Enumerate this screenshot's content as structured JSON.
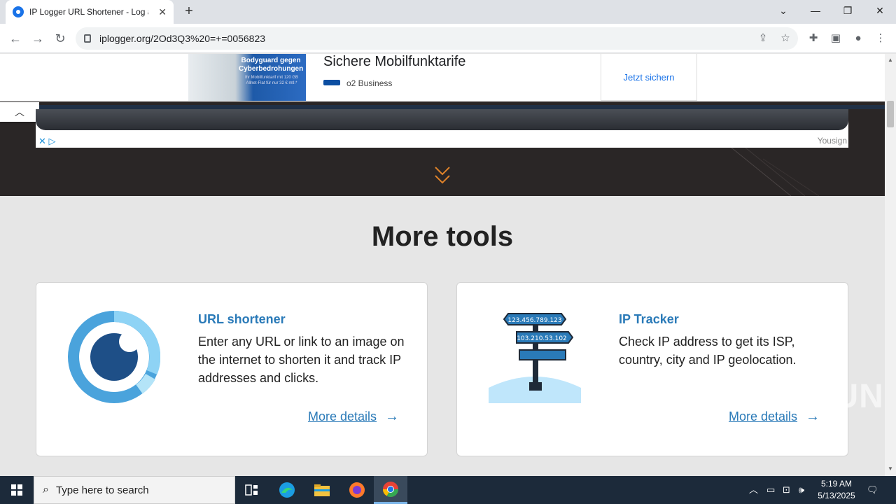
{
  "browser": {
    "tab_title": "IP Logger URL Shortener - Log a",
    "url": "iplogger.org/2Od3Q3%20=+=0056823",
    "new_tab": "+",
    "tab_close": "✕",
    "win_minimize": "—",
    "win_restore": "❐",
    "win_close": "✕",
    "tab_list": "⌄"
  },
  "ad_top": {
    "image_headline": "Bodyguard gegen Cyberbedrohungen",
    "image_small": "Ihr Mobilfunktarif mit 120 GB Allnet-Flat für nur 32 € mtl.*",
    "title": "Sichere Mobilfunktarife",
    "advertiser": "o2 Business",
    "cta": "Jetzt sichern"
  },
  "ad_banner": {
    "brand": "Yousign"
  },
  "main": {
    "heading": "More tools",
    "cards": [
      {
        "title": "URL shortener",
        "description": "Enter any URL or link to an image on the internet to shorten it and track IP addresses and clicks.",
        "link": "More details"
      },
      {
        "title": "IP Tracker",
        "description": "Check IP address to get its ISP, country, city and IP geolocation.",
        "link": "More details",
        "sign_ips": [
          "123.456.789.123",
          "103.210.53.102"
        ]
      }
    ]
  },
  "watermark": "ANY RUN",
  "taskbar": {
    "search_placeholder": "Type here to search",
    "time": "5:19 AM",
    "date": "5/13/2025"
  },
  "colors": {
    "accent": "#2a7ab8",
    "dark_bg": "#2a2626",
    "taskbar_bg": "#1c2a3a"
  }
}
